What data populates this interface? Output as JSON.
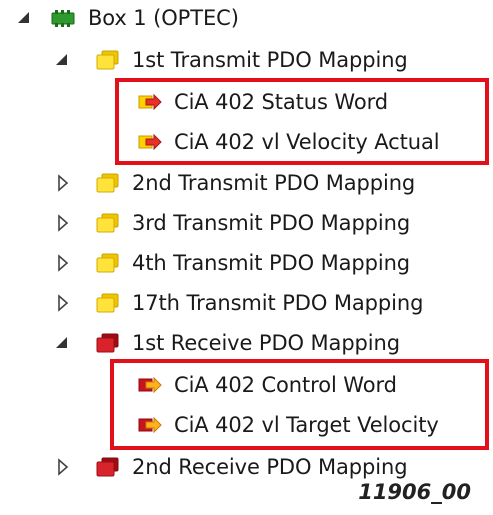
{
  "tree": {
    "root": {
      "label": "Box 1 (OPTEC)",
      "icon": "device-box-icon",
      "expanded": true
    },
    "groups": [
      {
        "label": "1st Transmit PDO Mapping",
        "kind": "transmit",
        "expanded": true
      },
      {
        "label": "2nd Transmit PDO Mapping",
        "kind": "transmit",
        "expanded": false
      },
      {
        "label": "3rd Transmit PDO Mapping",
        "kind": "transmit",
        "expanded": false
      },
      {
        "label": "4th Transmit PDO Mapping",
        "kind": "transmit",
        "expanded": false
      },
      {
        "label": "17th Transmit PDO Mapping",
        "kind": "transmit",
        "expanded": false
      },
      {
        "label": "1st Receive PDO Mapping",
        "kind": "receive",
        "expanded": true
      },
      {
        "label": "2nd Receive PDO Mapping",
        "kind": "receive",
        "expanded": false
      }
    ],
    "transmit_entries": [
      {
        "label": "CiA 402 Status Word"
      },
      {
        "label": "CiA 402 vl Velocity Actual"
      }
    ],
    "receive_entries": [
      {
        "label": "CiA 402 Control Word"
      },
      {
        "label": "CiA 402 vl Target Velocity"
      }
    ]
  },
  "figure_code": "11906_00",
  "colors": {
    "highlight": "#e2101b",
    "transmit_folder": "#ffd800",
    "receive_folder": "#c8141c",
    "device": "#2e9a2e"
  }
}
